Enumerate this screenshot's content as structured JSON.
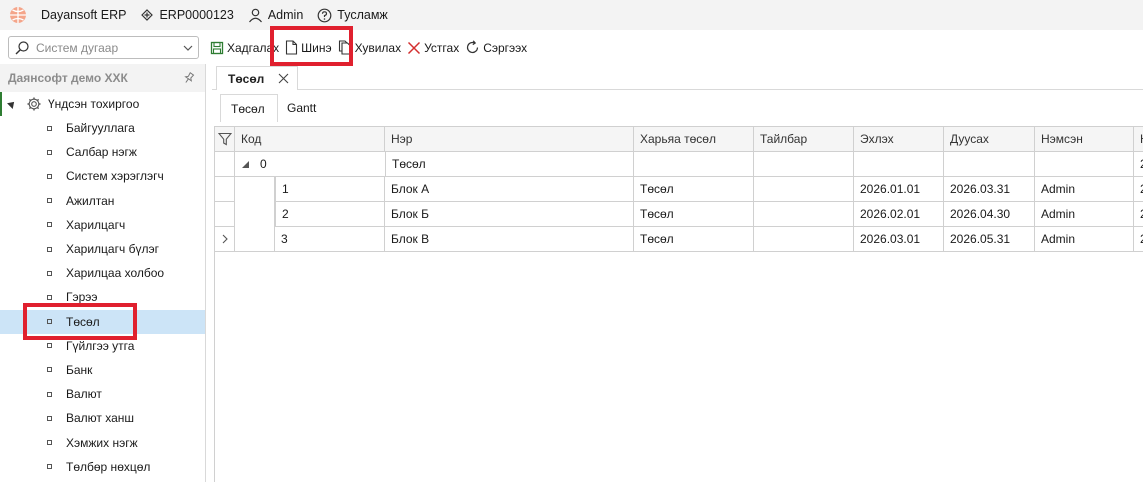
{
  "app": {
    "name": "Dayansoft ERP",
    "db": "ERP0000123",
    "user": "Admin",
    "help": "Тусламж"
  },
  "search": {
    "placeholder": "Систем дугаар"
  },
  "toolbar": {
    "save": "Хадгалах",
    "new": "Шинэ",
    "copy": "Хувилах",
    "delete": "Устгах",
    "refresh": "Сэргээх"
  },
  "sidebar": {
    "company": "Даянсофт демо ХХК",
    "root": "Үндсэн тохиргоо",
    "items": [
      "Байгууллага",
      "Салбар нэгж",
      "Систем хэрэглэгч",
      "Ажилтан",
      "Харилцагч",
      "Харилцагч бүлэг",
      "Харилцаа холбоо",
      "Гэрээ",
      "Төсөл",
      "Гүйлгээ утга",
      "Банк",
      "Валют",
      "Валют ханш",
      "Хэмжих нэгж",
      "Төлбөр нөхцөл"
    ],
    "selected_index": 8
  },
  "doc_tab": {
    "label": "Төсөл"
  },
  "sub_tabs": [
    "Төсөл",
    "Gantt"
  ],
  "grid": {
    "columns": [
      "Код",
      "Нэр",
      "Харьяа төсөл",
      "Тайлбар",
      "Эхлэх",
      "Дуусах",
      "Нэмсэн",
      "Н"
    ],
    "parent": {
      "code": "0",
      "name": "Төсөл",
      "extra": "2"
    },
    "rows": [
      {
        "code": "1",
        "name": "Блок А",
        "parent": "Төсөл",
        "note": "",
        "start": "2026.01.01",
        "end": "2026.03.31",
        "added": "Admin",
        "extra": "2"
      },
      {
        "code": "2",
        "name": "Блок Б",
        "parent": "Төсөл",
        "note": "",
        "start": "2026.02.01",
        "end": "2026.04.30",
        "added": "Admin",
        "extra": "2"
      },
      {
        "code": "3",
        "name": "Блок В",
        "parent": "Төсөл",
        "note": "",
        "start": "2026.03.01",
        "end": "2026.05.31",
        "added": "Admin",
        "extra": "2"
      }
    ]
  },
  "colors": {
    "highlight": "#e0202e",
    "selection": "#cce4f7",
    "save_icon": "#2e7d32",
    "delete_icon": "#d32f2f"
  }
}
